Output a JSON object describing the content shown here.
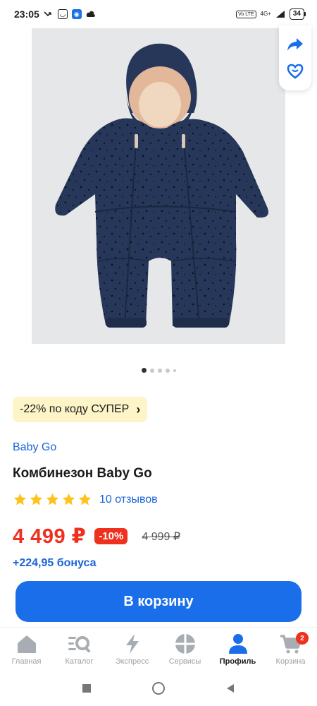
{
  "status_bar": {
    "time": "23:05",
    "network": "4G+",
    "volte": "Vo LTE",
    "battery": "34"
  },
  "product": {
    "promo": "-22% по коду СУПЕР",
    "brand": "Baby Go",
    "title": "Комбинезон Baby Go",
    "rating_stars": 5,
    "reviews": "10 отзывов",
    "price": "4 499 ₽",
    "discount": "-10%",
    "old_price": "4 999 ₽",
    "bonus": "+224,95 бонуса",
    "image_count": 5,
    "active_image": 1
  },
  "cart_button": "В корзину",
  "bottom_nav": {
    "items": [
      {
        "label": "Главная",
        "icon": "home-icon"
      },
      {
        "label": "Каталог",
        "icon": "catalog-search-icon"
      },
      {
        "label": "Экспресс",
        "icon": "lightning-icon"
      },
      {
        "label": "Сервисы",
        "icon": "services-icon"
      },
      {
        "label": "Профиль",
        "icon": "profile-icon",
        "active": true
      },
      {
        "label": "Корзина",
        "icon": "cart-icon",
        "badge": "2"
      }
    ]
  },
  "colors": {
    "accent_blue": "#1a6eea",
    "price_red": "#f0301e",
    "promo_bg": "#fdf4c8",
    "star_yellow": "#ffc21a"
  }
}
